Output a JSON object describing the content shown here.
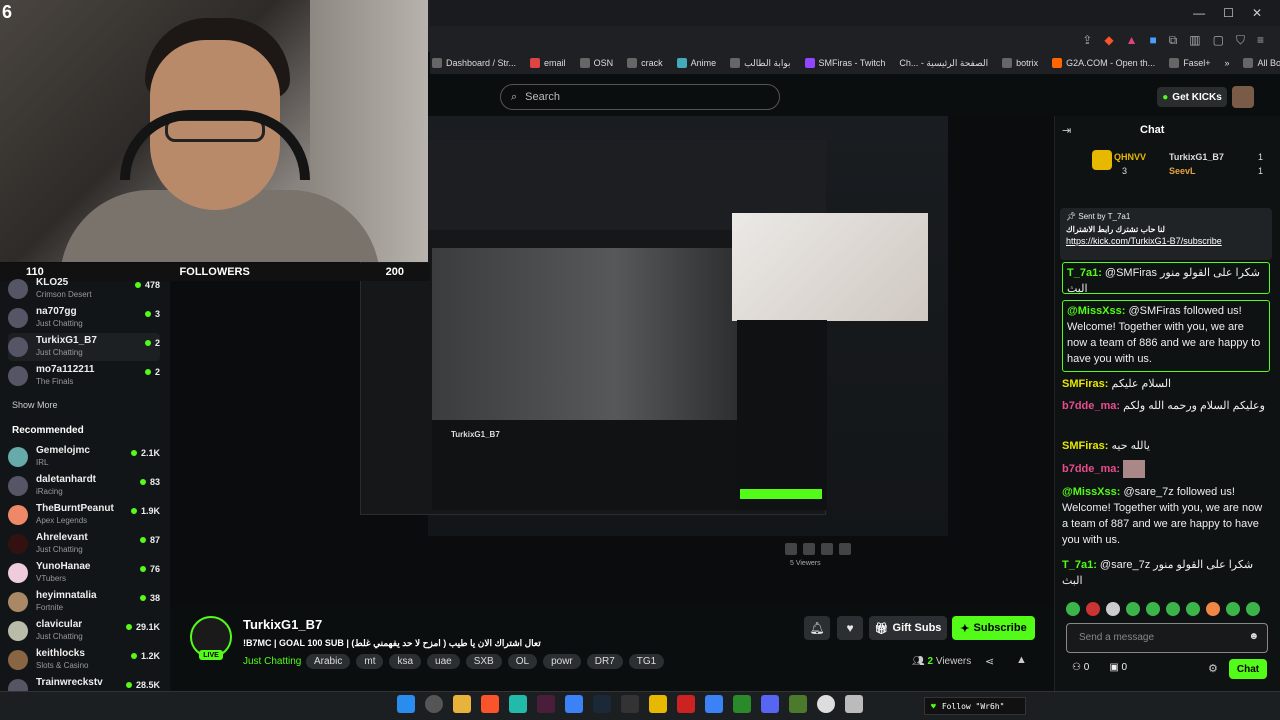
{
  "browser": {
    "window_controls": [
      "—",
      "☐",
      "✕"
    ],
    "bookmarks": [
      "Dashboard / Str...",
      "email",
      "OSN",
      "crack",
      "Anime",
      "بوابة الطالب",
      "SMFiras - Twitch",
      "Ch... - الصفحة الرئيسية",
      "botrix",
      "G2A.COM - Open th...",
      "Fasel+"
    ],
    "all_bookmarks": "All Bookmarks"
  },
  "header": {
    "search_placeholder": "Search",
    "get_kicks": "Get KICKs"
  },
  "overlay": {
    "number": "6",
    "goal_left": "110",
    "goal_label": "FOLLOWERS",
    "goal_right": "200"
  },
  "sidebar": {
    "following": [
      {
        "name": "KLO25",
        "category": "Crimson Desert",
        "viewers": "478"
      },
      {
        "name": "na707gg",
        "category": "Just Chatting",
        "viewers": "3"
      },
      {
        "name": "TurkixG1_B7",
        "category": "Just Chatting",
        "viewers": "2"
      },
      {
        "name": "mo7a112211",
        "category": "The Finals",
        "viewers": "2"
      }
    ],
    "show_more": "Show More",
    "recommended_title": "Recommended",
    "recommended": [
      {
        "name": "Gemelojmc",
        "category": "IRL",
        "viewers": "2.1K"
      },
      {
        "name": "daletanhardt",
        "category": "iRacing",
        "viewers": "83"
      },
      {
        "name": "TheBurntPeanut",
        "category": "Apex Legends",
        "viewers": "1.9K"
      },
      {
        "name": "Ahrelevant",
        "category": "Just Chatting",
        "viewers": "87"
      },
      {
        "name": "YunoHanae",
        "category": "VTubers",
        "viewers": "76"
      },
      {
        "name": "heyimnatalia",
        "category": "Fortnite",
        "viewers": "38"
      },
      {
        "name": "clavicular",
        "category": "Just Chatting",
        "viewers": "29.1K"
      },
      {
        "name": "keithlocks",
        "category": "Slots & Casino",
        "viewers": "1.2K"
      },
      {
        "name": "Trainwreckstv",
        "category": "",
        "viewers": "28.5K"
      }
    ]
  },
  "stream": {
    "name": "TurkixG1_B7",
    "live": "LIVE",
    "title": "!B7MC | GOAL 100 SUB | تعال اشتراك الان يا طيب ( امزح لا حد يفهمني غلط)",
    "category": "Just Chatting",
    "tags": [
      "Arabic",
      "mt",
      "ksa",
      "uae",
      "SXB",
      "OL",
      "powr",
      "DR7",
      "TG1"
    ],
    "gift_subs": "Gift Subs",
    "subscribe": "Subscribe",
    "viewers_count": "2",
    "viewers_label": "Viewers",
    "inner_stream_name": "TurkixG1_B7",
    "inner_viewers": "5 Viewers"
  },
  "chat": {
    "title": "Chat",
    "gifters": [
      {
        "name": "QHNVV",
        "count": "3"
      },
      {
        "name": "TurkixG1_B7",
        "count": "1"
      },
      {
        "name": "SeevL",
        "count": "1"
      }
    ],
    "pinned": {
      "sent_by": "Sent by",
      "sender": "T_7a1",
      "text": "لنا حاب تشترك رابط الاشتراك",
      "link": "https://kick.com/TurkixG1-B7/subscribe"
    },
    "messages": [
      {
        "user": "T_7a1:",
        "text": "@SMFiras شكرا على القولو منور البث",
        "color": "#53fc18"
      },
      {
        "user": "@MissXss:",
        "text": "@SMFiras followed us! Welcome! Together with you, we are now a team of 886 and we are happy to have you with us.",
        "color": "#53fc18"
      },
      {
        "user": "SMFiras:",
        "text": "السلام عليكم",
        "color": "#e6e600"
      },
      {
        "user": "b7dde_ma:",
        "text": "وعليكم السلام ورحمه الله ولكم",
        "color": "#e84c8f"
      },
      {
        "user": "SMFiras:",
        "text": "يالله حيه",
        "color": "#e6e600"
      },
      {
        "user": "b7dde_ma:",
        "text": "",
        "color": "#e84c8f"
      },
      {
        "user": "@MissXss:",
        "text": "@sare_7z followed us! Welcome! Together with you, we are now a team of 887 and we are happy to have you with us.",
        "color": "#53fc18"
      },
      {
        "user": "T_7a1:",
        "text": "@sare_7z شكرا على القولو منور البث",
        "color": "#53fc18"
      }
    ],
    "input_placeholder": "Send a message",
    "points": "0",
    "gifts": "0",
    "send": "Chat"
  },
  "taskbar": {
    "follow_notice": "Follow \"Wr6h\""
  },
  "colors": {
    "accent": "#53fc18",
    "bg": "#0b0e0f"
  }
}
